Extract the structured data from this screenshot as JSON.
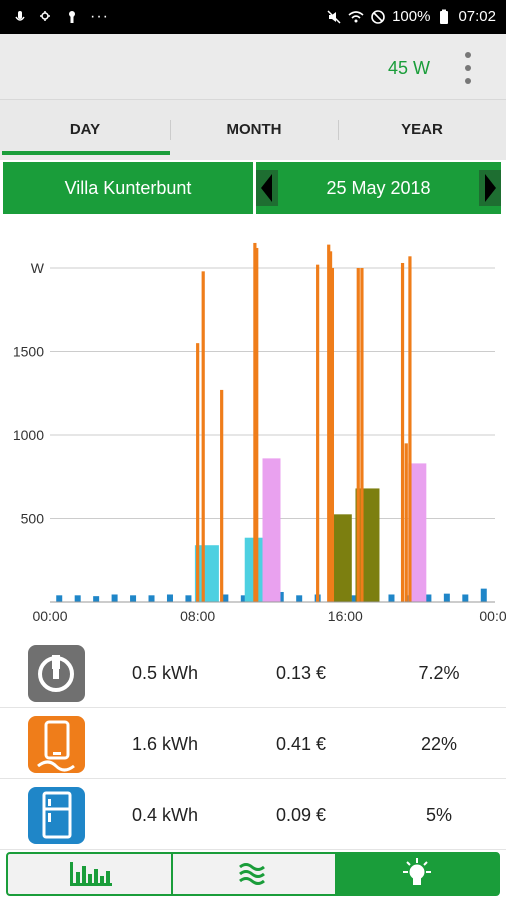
{
  "status_bar": {
    "battery": "100%",
    "time": "07:02"
  },
  "header": {
    "power": "45 W"
  },
  "tabs": [
    {
      "label": "DAY"
    },
    {
      "label": "MONTH"
    },
    {
      "label": "YEAR"
    }
  ],
  "selector": {
    "location": "Villa Kunterbunt",
    "date": "25 May 2018"
  },
  "chart_data": {
    "type": "bar",
    "ylabel": "W",
    "ylim": [
      0,
      2000
    ],
    "yticks": [
      "500",
      "1000",
      "1500",
      "W"
    ],
    "xticks": [
      "00:00",
      "08:00",
      "16:00",
      "00:0"
    ],
    "grid": true,
    "series": [
      {
        "values": [
          [
            8.0,
            1550
          ],
          [
            8.3,
            1980
          ],
          [
            9.3,
            1270
          ],
          [
            11.1,
            2150
          ],
          [
            11.2,
            2120
          ],
          [
            14.5,
            2020
          ],
          [
            15.1,
            2140
          ],
          [
            15.2,
            2100
          ],
          [
            15.3,
            2000
          ],
          [
            16.7,
            2000
          ],
          [
            16.9,
            2000
          ],
          [
            19.1,
            2030
          ],
          [
            19.3,
            950
          ],
          [
            19.5,
            2070
          ]
        ],
        "color": "#ef7d1a"
      },
      {
        "values": [
          [
            8.5,
            340
          ],
          [
            11.2,
            385
          ]
        ],
        "color": "#4dd0e1"
      },
      {
        "values": [
          [
            12.0,
            860
          ],
          [
            19.9,
            830
          ]
        ],
        "color": "#e9a1ef"
      },
      {
        "values": [
          [
            15.7,
            525
          ],
          [
            17.2,
            680
          ]
        ],
        "color": "#7c7f10"
      },
      {
        "values": [
          40,
          40,
          35,
          45,
          40,
          40,
          45,
          40,
          50,
          45,
          40,
          45,
          60,
          40,
          45,
          35,
          40,
          50,
          45,
          40,
          45,
          50,
          45,
          80
        ],
        "color": "#1f86c8"
      }
    ]
  },
  "rows": [
    {
      "icon": "plug-icon",
      "kwh": "0.5 kWh",
      "cost": "0.13 €",
      "pct": "7.2%",
      "color": "#707070"
    },
    {
      "icon": "boiler-icon",
      "kwh": "1.6 kWh",
      "cost": "0.41 €",
      "pct": "22%",
      "color": "#ef7d1a"
    },
    {
      "icon": "fridge-icon",
      "kwh": "0.4 kWh",
      "cost": "0.09 €",
      "pct": "5%",
      "color": "#1f86c8"
    }
  ],
  "bottom_nav": [
    {
      "icon": "bar-chart-icon"
    },
    {
      "icon": "wave-icon"
    },
    {
      "icon": "lightbulb-icon"
    }
  ]
}
